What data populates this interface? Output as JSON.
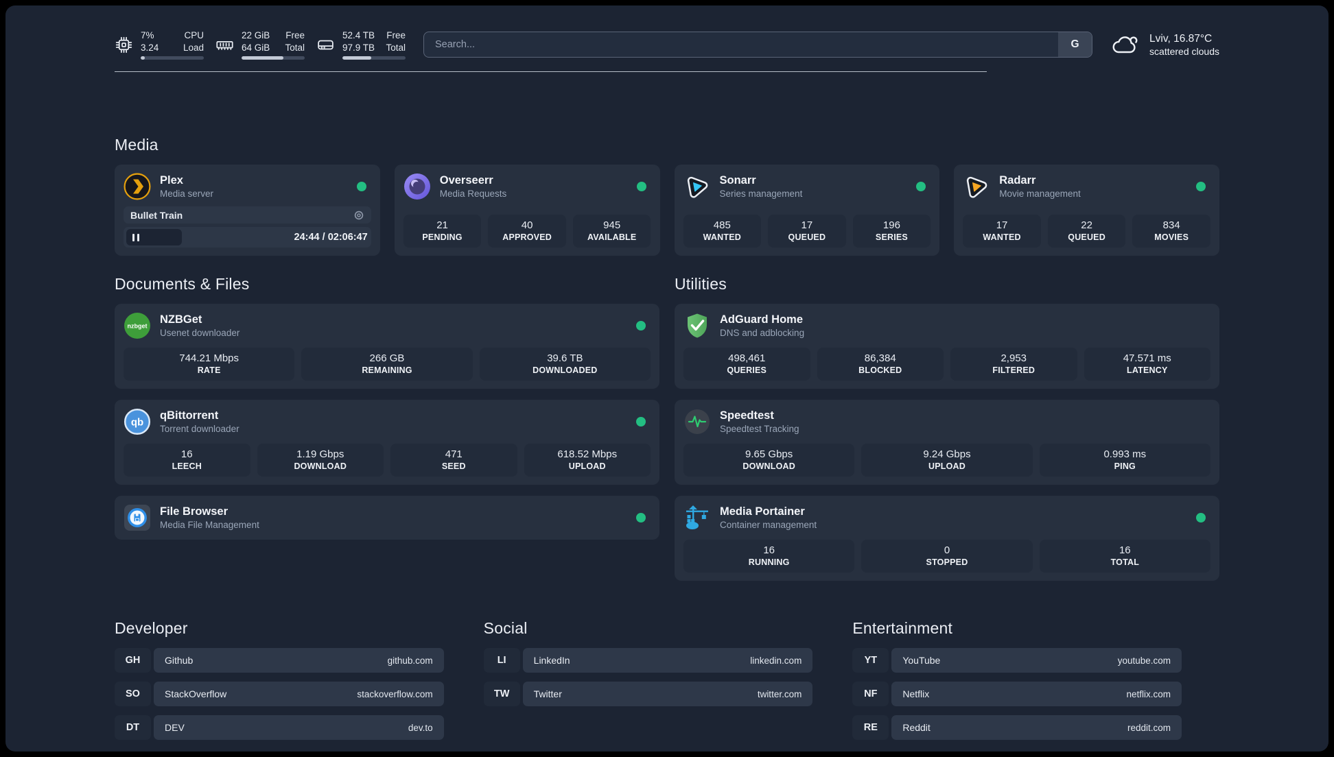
{
  "topbar": {
    "cpu": {
      "value_top": "7%",
      "value_bottom": "3.24",
      "label_top": "CPU",
      "label_bottom": "Load",
      "progress": 7
    },
    "memory": {
      "value_top": "22 GiB",
      "value_bottom": "64 GiB",
      "label_top": "Free",
      "label_bottom": "Total",
      "progress": 66
    },
    "disk": {
      "value_top": "52.4 TB",
      "value_bottom": "97.9 TB",
      "label_top": "Free",
      "label_bottom": "Total",
      "progress": 46
    },
    "search": {
      "placeholder": "Search...",
      "provider": "G"
    },
    "weather": {
      "location": "Lviv, 16.87°C",
      "condition": "scattered clouds"
    }
  },
  "sections": {
    "media": "Media",
    "documents": "Documents & Files",
    "utilities": "Utilities"
  },
  "apps": {
    "plex": {
      "name": "Plex",
      "description": "Media server",
      "now_playing": "Bullet Train",
      "time": "24:44 / 02:06:47"
    },
    "overseerr": {
      "name": "Overseerr",
      "description": "Media Requests",
      "stats": [
        {
          "value": "21",
          "label": "PENDING"
        },
        {
          "value": "40",
          "label": "APPROVED"
        },
        {
          "value": "945",
          "label": "AVAILABLE"
        }
      ]
    },
    "sonarr": {
      "name": "Sonarr",
      "description": "Series management",
      "stats": [
        {
          "value": "485",
          "label": "WANTED"
        },
        {
          "value": "17",
          "label": "QUEUED"
        },
        {
          "value": "196",
          "label": "SERIES"
        }
      ]
    },
    "radarr": {
      "name": "Radarr",
      "description": "Movie management",
      "stats": [
        {
          "value": "17",
          "label": "WANTED"
        },
        {
          "value": "22",
          "label": "QUEUED"
        },
        {
          "value": "834",
          "label": "MOVIES"
        }
      ]
    },
    "nzbget": {
      "name": "NZBGet",
      "description": "Usenet downloader",
      "stats": [
        {
          "value": "744.21 Mbps",
          "label": "RATE"
        },
        {
          "value": "266 GB",
          "label": "REMAINING"
        },
        {
          "value": "39.6 TB",
          "label": "DOWNLOADED"
        }
      ]
    },
    "qbittorrent": {
      "name": "qBittorrent",
      "description": "Torrent downloader",
      "stats": [
        {
          "value": "16",
          "label": "LEECH"
        },
        {
          "value": "1.19 Gbps",
          "label": "DOWNLOAD"
        },
        {
          "value": "471",
          "label": "SEED"
        },
        {
          "value": "618.52 Mbps",
          "label": "UPLOAD"
        }
      ]
    },
    "filebrowser": {
      "name": "File Browser",
      "description": "Media File Management"
    },
    "adguard": {
      "name": "AdGuard Home",
      "description": "DNS and adblocking",
      "stats": [
        {
          "value": "498,461",
          "label": "QUERIES"
        },
        {
          "value": "86,384",
          "label": "BLOCKED"
        },
        {
          "value": "2,953",
          "label": "FILTERED"
        },
        {
          "value": "47.571 ms",
          "label": "LATENCY"
        }
      ]
    },
    "speedtest": {
      "name": "Speedtest",
      "description": "Speedtest Tracking",
      "stats": [
        {
          "value": "9.65 Gbps",
          "label": "DOWNLOAD"
        },
        {
          "value": "9.24 Gbps",
          "label": "UPLOAD"
        },
        {
          "value": "0.993 ms",
          "label": "PING"
        }
      ]
    },
    "portainer": {
      "name": "Media Portainer",
      "description": "Container management",
      "stats": [
        {
          "value": "16",
          "label": "RUNNING"
        },
        {
          "value": "0",
          "label": "STOPPED"
        },
        {
          "value": "16",
          "label": "TOTAL"
        }
      ]
    }
  },
  "bookmarks": {
    "developer": {
      "title": "Developer",
      "items": [
        {
          "abbr": "GH",
          "name": "Github",
          "url": "github.com"
        },
        {
          "abbr": "SO",
          "name": "StackOverflow",
          "url": "stackoverflow.com"
        },
        {
          "abbr": "DT",
          "name": "DEV",
          "url": "dev.to"
        }
      ]
    },
    "social": {
      "title": "Social",
      "items": [
        {
          "abbr": "LI",
          "name": "LinkedIn",
          "url": "linkedin.com"
        },
        {
          "abbr": "TW",
          "name": "Twitter",
          "url": "twitter.com"
        }
      ]
    },
    "entertainment": {
      "title": "Entertainment",
      "items": [
        {
          "abbr": "YT",
          "name": "YouTube",
          "url": "youtube.com"
        },
        {
          "abbr": "NF",
          "name": "Netflix",
          "url": "netflix.com"
        },
        {
          "abbr": "RE",
          "name": "Reddit",
          "url": "reddit.com"
        }
      ]
    }
  },
  "colors": {
    "background": "#1c2433",
    "card": "#27303f",
    "status_online": "#23be82",
    "plex_accent": "#e5a00d",
    "sonarr_accent": "#35c5f4",
    "radarr_accent": "#f5a623",
    "nzbget_accent": "#3e9e3a",
    "qbittorrent_accent": "#4a93dd",
    "adguard_accent": "#5cb867",
    "speedtest_accent": "#2ecc71",
    "portainer_accent": "#2fa9e2",
    "filebrowser_accent": "#2f8fe8"
  }
}
